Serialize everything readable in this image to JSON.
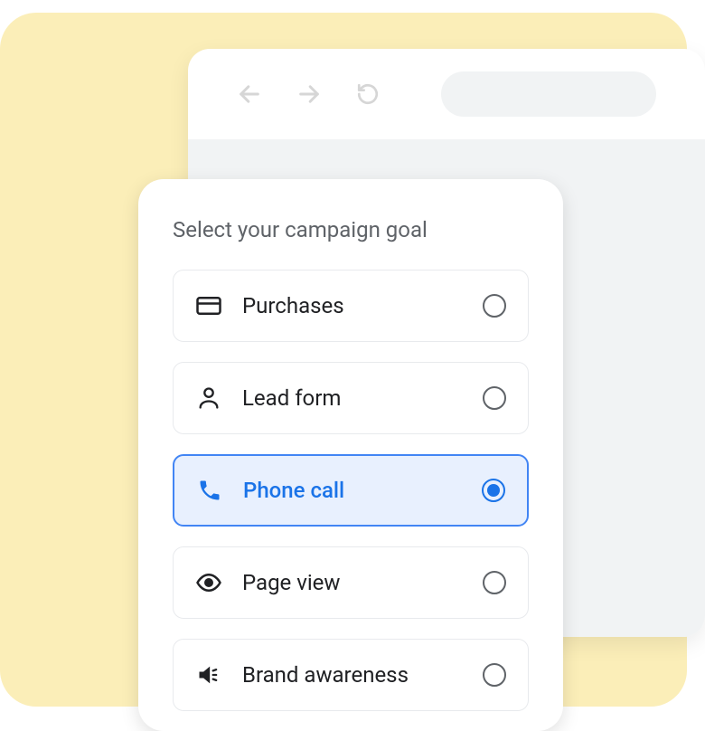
{
  "card": {
    "title": "Select your campaign goal",
    "options": [
      {
        "icon": "credit-card",
        "label": "Purchases",
        "selected": false
      },
      {
        "icon": "person",
        "label": "Lead form",
        "selected": false
      },
      {
        "icon": "phone",
        "label": "Phone call",
        "selected": true
      },
      {
        "icon": "eye",
        "label": "Page view",
        "selected": false
      },
      {
        "icon": "megaphone",
        "label": "Brand awareness",
        "selected": false
      }
    ]
  }
}
